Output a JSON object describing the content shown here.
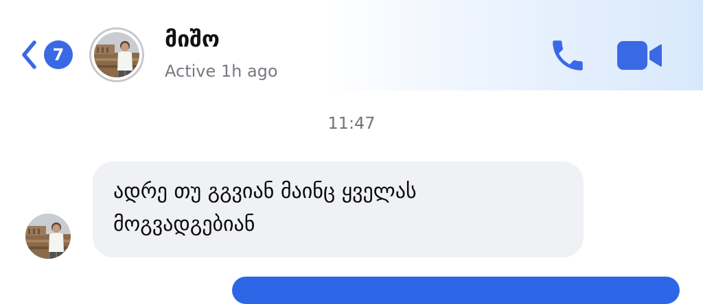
{
  "header": {
    "back_badge_count": "7",
    "contact_name": "მიშო",
    "status": "Active 1h ago"
  },
  "conversation": {
    "timestamp": "11:47",
    "messages": [
      {
        "direction": "incoming",
        "lines": [
          "ადრე თუ გგვიან მაინც ყველას",
          "მოგვადგებიან"
        ]
      }
    ]
  },
  "icons": {
    "back": "chevron-left-icon",
    "call": "phone-icon",
    "video": "video-camera-icon"
  },
  "colors": {
    "accent": "#3a69e6",
    "incoming_bubble": "#f0f1f4",
    "outgoing_bubble": "#2d66e6",
    "secondary_text": "#757a80"
  }
}
